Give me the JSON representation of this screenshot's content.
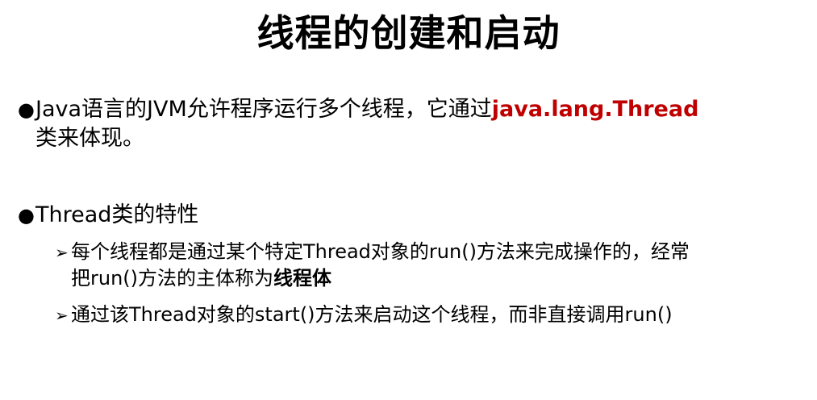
{
  "slide": {
    "title": "线程的创建和启动",
    "bullet1": {
      "marker": "●",
      "text_a": "Java语言的JVM允许程序运行多个线程，它通过",
      "highlight": "java.lang.Thread",
      "text_b": "类来体现。",
      "highlight_color": "#c00000"
    },
    "bullet2": {
      "marker": "●",
      "text": "Thread类的特性"
    },
    "sub1": {
      "marker": "➢",
      "line1": "每个线程都是通过某个特定Thread对象的run()方法来完成操作的，经常",
      "line2_a": "把run()方法的主体称为",
      "line2_bold": "线程体"
    },
    "sub2": {
      "marker": "➢",
      "text": "通过该Thread对象的start()方法来启动这个线程，而非直接调用run()"
    }
  }
}
